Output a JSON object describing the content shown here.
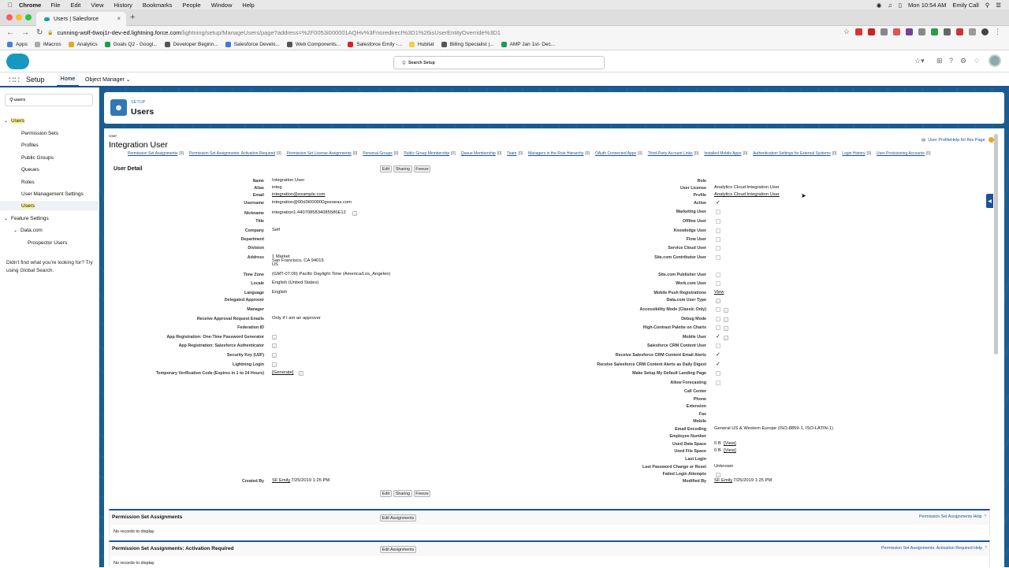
{
  "mac_menu": {
    "app": "Chrome",
    "items": [
      "File",
      "Edit",
      "View",
      "History",
      "Bookmarks",
      "People",
      "Window",
      "Help"
    ],
    "clock": "Mon 10:54 AM",
    "user": "Emily Call"
  },
  "browser": {
    "tab_title": "Users | Salesforce",
    "url_host": "cunning-wolf-6woj1r-dev-ed.lightning.force.com",
    "url_path": "/lightning/setup/ManageUsers/page?address=%2F0053i000001AQHv%3Fnoredirect%3D1%26isUserEntityOverride%3D1",
    "bookmarks": [
      "Apps",
      "iMacros",
      "Analytics",
      "Goals Q2 - Googl...",
      "Developer Beginn...",
      "Salesforce Develo...",
      "Web Components...",
      "Salesforce Emily -...",
      "Hubitat",
      "Billing Specialist |...",
      "AMP Jan 1st- Dec..."
    ]
  },
  "header": {
    "search_placeholder": "Search Setup",
    "app_name": "Setup",
    "tabs": [
      "Home",
      "Object Manager"
    ]
  },
  "sidebar": {
    "quick_find": "users",
    "items": [
      {
        "label": "Users",
        "level": 0,
        "highlight": true,
        "expanded": true
      },
      {
        "label": "Permission Sets",
        "level": 1
      },
      {
        "label": "Profiles",
        "level": 1
      },
      {
        "label": "Public Groups",
        "level": 1
      },
      {
        "label": "Queues",
        "level": 1
      },
      {
        "label": "Roles",
        "level": 1
      },
      {
        "label": "User Management Settings",
        "level": 1
      },
      {
        "label": "Users",
        "level": 1,
        "highlight": true
      },
      {
        "label": "Feature Settings",
        "level": 0,
        "expanded": true
      },
      {
        "label": "Data.com",
        "level": 1,
        "expanded": true
      },
      {
        "label": "Prospector Users",
        "level": 2
      }
    ],
    "help_text": "Didn't find what you're looking for? Try using Global Search."
  },
  "page": {
    "caption": "SETUP",
    "title": "Users"
  },
  "detail": {
    "caption": "User",
    "name": "Integration User",
    "help_link": "User Profile",
    "help_link_rest": "Help for this Page",
    "related_links": [
      "Permission Set Assignments",
      "Permission Set Assignments: Activation Required",
      "Permission Set License Assignments",
      "Personal Groups",
      "Public Group Membership",
      "Queue Membership",
      "Team",
      "Managers in the Role Hierarchy",
      "OAuth Connected Apps",
      "Third-Party Account Links",
      "Installed Mobile Apps",
      "Authentication Settings for External Systems",
      "Login History",
      "User Provisioning Accounts"
    ],
    "related_count": "[0]",
    "section_title": "User Detail",
    "buttons": [
      "Edit",
      "Sharing",
      "Freeze"
    ],
    "left_fields": [
      {
        "label": "Name",
        "value": "Integration User"
      },
      {
        "label": "Alias",
        "value": "integ"
      },
      {
        "label": "Email",
        "value": "integration@example.com",
        "link": true
      },
      {
        "label": "Username",
        "value": "integration@00d3i000000gxeoeas.com"
      },
      {
        "label": "Nickname",
        "value": "integration1.4407085834085586E12",
        "info": true
      },
      {
        "label": "Title",
        "value": ""
      },
      {
        "label": "Company",
        "value": "Self"
      },
      {
        "label": "Department",
        "value": ""
      },
      {
        "label": "Division",
        "value": ""
      },
      {
        "label": "Address",
        "value": "1 Market",
        "value2": "San Francisco, CA 94015",
        "value3": "US"
      },
      {
        "label": "Time Zone",
        "value": "(GMT-07:00) Pacific Daylight Time (America/Los_Angeles)"
      },
      {
        "label": "Locale",
        "value": "English (United States)"
      },
      {
        "label": "Language",
        "value": "English"
      },
      {
        "label": "Delegated Approver",
        "value": ""
      },
      {
        "label": "Manager",
        "value": ""
      },
      {
        "label": "Receive Approval Request Emails",
        "value": "Only if I am an approver"
      },
      {
        "label": "Federation ID",
        "value": ""
      },
      {
        "label": "App Registration: One-Time Password Generator",
        "value": "",
        "info": true
      },
      {
        "label": "App Registration: Salesforce Authenticator",
        "value": "",
        "info": true
      },
      {
        "label": "Security Key (U2F)",
        "value": "",
        "info": true
      },
      {
        "label": "Lightning Login",
        "value": "",
        "info": true
      },
      {
        "label": "Temporary Verification Code (Expires in 1 to 24 Hours)",
        "value": "[Generate]",
        "link": true,
        "info": true
      }
    ],
    "right_fields": [
      {
        "label": "Role",
        "value": ""
      },
      {
        "label": "User License",
        "value": "Analytics Cloud Integration User"
      },
      {
        "label": "Profile",
        "value": "Analytics Cloud Integration User",
        "link": true
      },
      {
        "label": "Active",
        "check": true
      },
      {
        "label": "Marketing User",
        "box": true
      },
      {
        "label": "Offline User",
        "box": true
      },
      {
        "label": "Knowledge User",
        "box": true
      },
      {
        "label": "Flow User",
        "box": true
      },
      {
        "label": "Service Cloud User",
        "box": true
      },
      {
        "label": "Site.com Contributor User",
        "box": true
      },
      {
        "label": "Site.com Publisher User",
        "box": true
      },
      {
        "label": "Work.com User",
        "box": true
      },
      {
        "label": "Mobile Push Registrations",
        "value": "View",
        "link": true
      },
      {
        "label": "Data.com User Type",
        "value": "",
        "info": true
      },
      {
        "label": "Accessibility Mode (Classic Only)",
        "box": true,
        "info": true
      },
      {
        "label": "Debug Mode",
        "box": true,
        "info": true
      },
      {
        "label": "High-Contrast Palette on Charts",
        "box": true,
        "info": true
      },
      {
        "label": "Mobile User",
        "check": true,
        "info": true
      },
      {
        "label": "Salesforce CRM Content User",
        "box": true
      },
      {
        "label": "Receive Salesforce CRM Content Email Alerts",
        "check": true
      },
      {
        "label": "Receive Salesforce CRM Content Alerts as Daily Digest",
        "check": true
      },
      {
        "label": "Make Setup My Default Landing Page",
        "box": true
      },
      {
        "label": "Allow Forecasting",
        "box": true
      },
      {
        "label": "Call Center",
        "value": ""
      },
      {
        "label": "Phone",
        "value": ""
      },
      {
        "label": "Extension",
        "value": ""
      },
      {
        "label": "Fax",
        "value": ""
      },
      {
        "label": "Mobile",
        "value": ""
      },
      {
        "label": "Email Encoding",
        "value": "General US & Western Europe (ISO-8859-1, ISO-LATIN-1)"
      },
      {
        "label": "Employee Number",
        "value": ""
      },
      {
        "label": "Used Data Space",
        "value": "0 B",
        "extra": "[View]"
      },
      {
        "label": "Used File Space",
        "value": "0 B",
        "extra": "[View]"
      },
      {
        "label": "Last Login",
        "value": ""
      },
      {
        "label": "Last Password Change or Reset",
        "value": "Unknown"
      },
      {
        "label": "Failed Login Attempts",
        "value": "",
        "info": true
      }
    ],
    "created_by_label": "Created By",
    "created_by_user": "SF Emily",
    "created_by_date": ", 7/25/2019 1:25 PM",
    "modified_by_label": "Modified By",
    "modified_by_user": "SF Emily",
    "modified_by_date": ", 7/25/2019 1:25 PM"
  },
  "related_lists": [
    {
      "title": "Permission Set Assignments",
      "button": "Edit Assignments",
      "help": "Permission Set Assignments Help",
      "empty": "No records to display"
    },
    {
      "title": "Permission Set Assignments: Activation Required",
      "button": "Edit Assignments",
      "help": "Permission Set Assignments: Activation Required Help",
      "empty": "No records to display"
    }
  ],
  "colors": {
    "brand": "#1798c1",
    "nav_accent": "#1b5297",
    "banner": "#1a5c90",
    "highlight": "#faf39a"
  }
}
